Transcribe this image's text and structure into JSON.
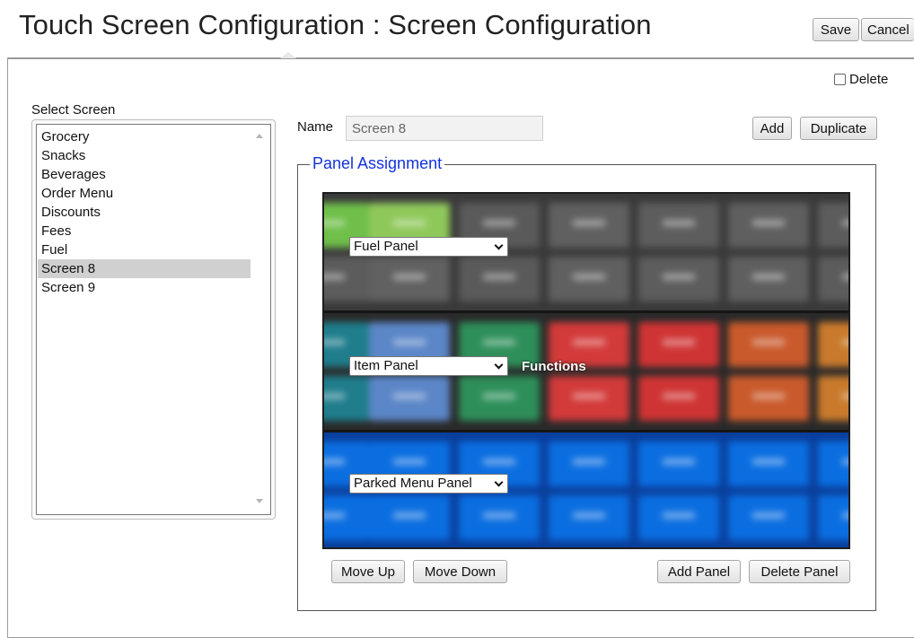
{
  "header": {
    "title": "Touch Screen Configuration : Screen Configuration",
    "save_label": "Save",
    "cancel_label": "Cancel"
  },
  "delete": {
    "label": "Delete",
    "checked": false
  },
  "screens": {
    "label": "Select Screen",
    "items": [
      {
        "label": "Grocery"
      },
      {
        "label": "Snacks"
      },
      {
        "label": "Beverages"
      },
      {
        "label": "Order Menu"
      },
      {
        "label": "Discounts"
      },
      {
        "label": "Fees"
      },
      {
        "label": "Fuel"
      },
      {
        "label": "Screen 8",
        "selected": true
      },
      {
        "label": "Screen 9"
      }
    ]
  },
  "name_field": {
    "label": "Name",
    "value": "Screen 8"
  },
  "actions": {
    "add_label": "Add",
    "duplicate_label": "Duplicate"
  },
  "panel_assignment": {
    "legend": "Panel Assignment",
    "panels": [
      {
        "selected": "Fuel Panel"
      },
      {
        "selected": "Item Panel",
        "note": "Functions"
      },
      {
        "selected": "Parked Menu Panel"
      }
    ],
    "move_up_label": "Move Up",
    "move_down_label": "Move Down",
    "add_panel_label": "Add Panel",
    "delete_panel_label": "Delete Panel"
  },
  "colors": {
    "legend": "#1432d9",
    "fuel_tiles": [
      "#6fbf4a",
      "#8fc85a",
      "#5c5c5c",
      "#616161",
      "#5a5a5a",
      "#606060",
      "#5d5d5d",
      "#5f5f5f"
    ],
    "item_tiles": [
      "#1f7d8c",
      "#5b86c7",
      "#2e8f5a",
      "#d33a3a",
      "#cf3434",
      "#c95a2c",
      "#c97a2c"
    ],
    "parked_tiles": "#0b6ee0"
  }
}
